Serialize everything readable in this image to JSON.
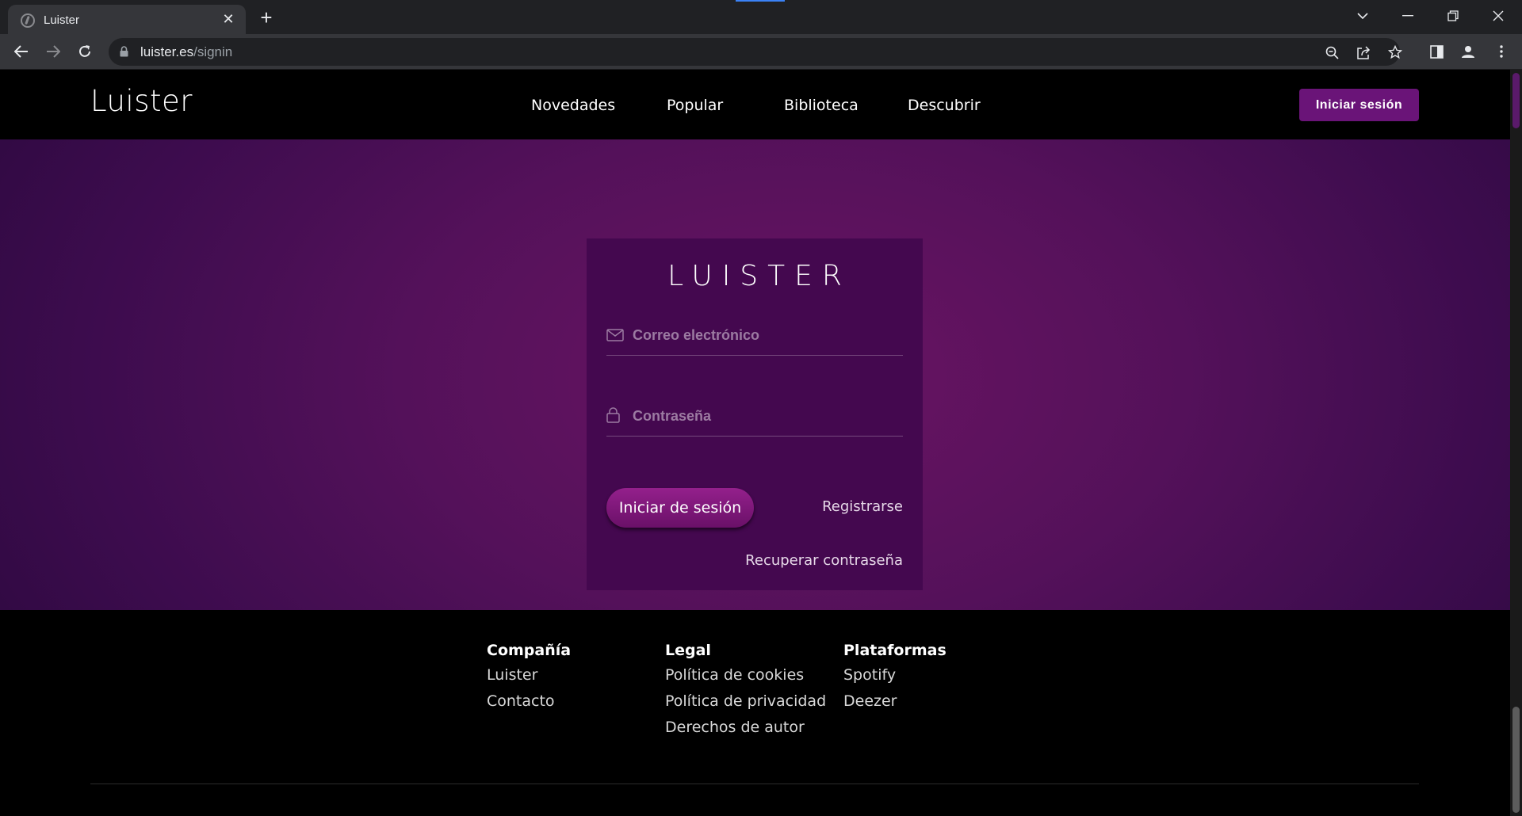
{
  "browser": {
    "tab_title": "Luister",
    "url_host": "luister.es",
    "url_path": "/signin"
  },
  "header": {
    "logo": "Luister",
    "nav": [
      "Novedades",
      "Popular",
      "Biblioteca",
      "Descubrir"
    ],
    "signin_button": "Iniciar sesión"
  },
  "login": {
    "logo": "LUISTER",
    "email_placeholder": "Correo electrónico",
    "password_placeholder": "Contraseña",
    "submit_label": "Iniciar de sesión",
    "register_label": "Registrarse",
    "recover_label": "Recuperar contraseña"
  },
  "footer": {
    "columns": [
      {
        "heading": "Compañía",
        "links": [
          "Luister",
          "Contacto"
        ]
      },
      {
        "heading": "Legal",
        "links": [
          "Política de cookies",
          "Política de privacidad",
          "Derechos de autor"
        ]
      },
      {
        "heading": "Plataformas",
        "links": [
          "Spotify",
          "Deezer"
        ]
      }
    ]
  },
  "colors": {
    "accent": "#6a1478",
    "card": "#44084f",
    "hero_center": "#6a1463",
    "hero_edge": "#320a44"
  }
}
